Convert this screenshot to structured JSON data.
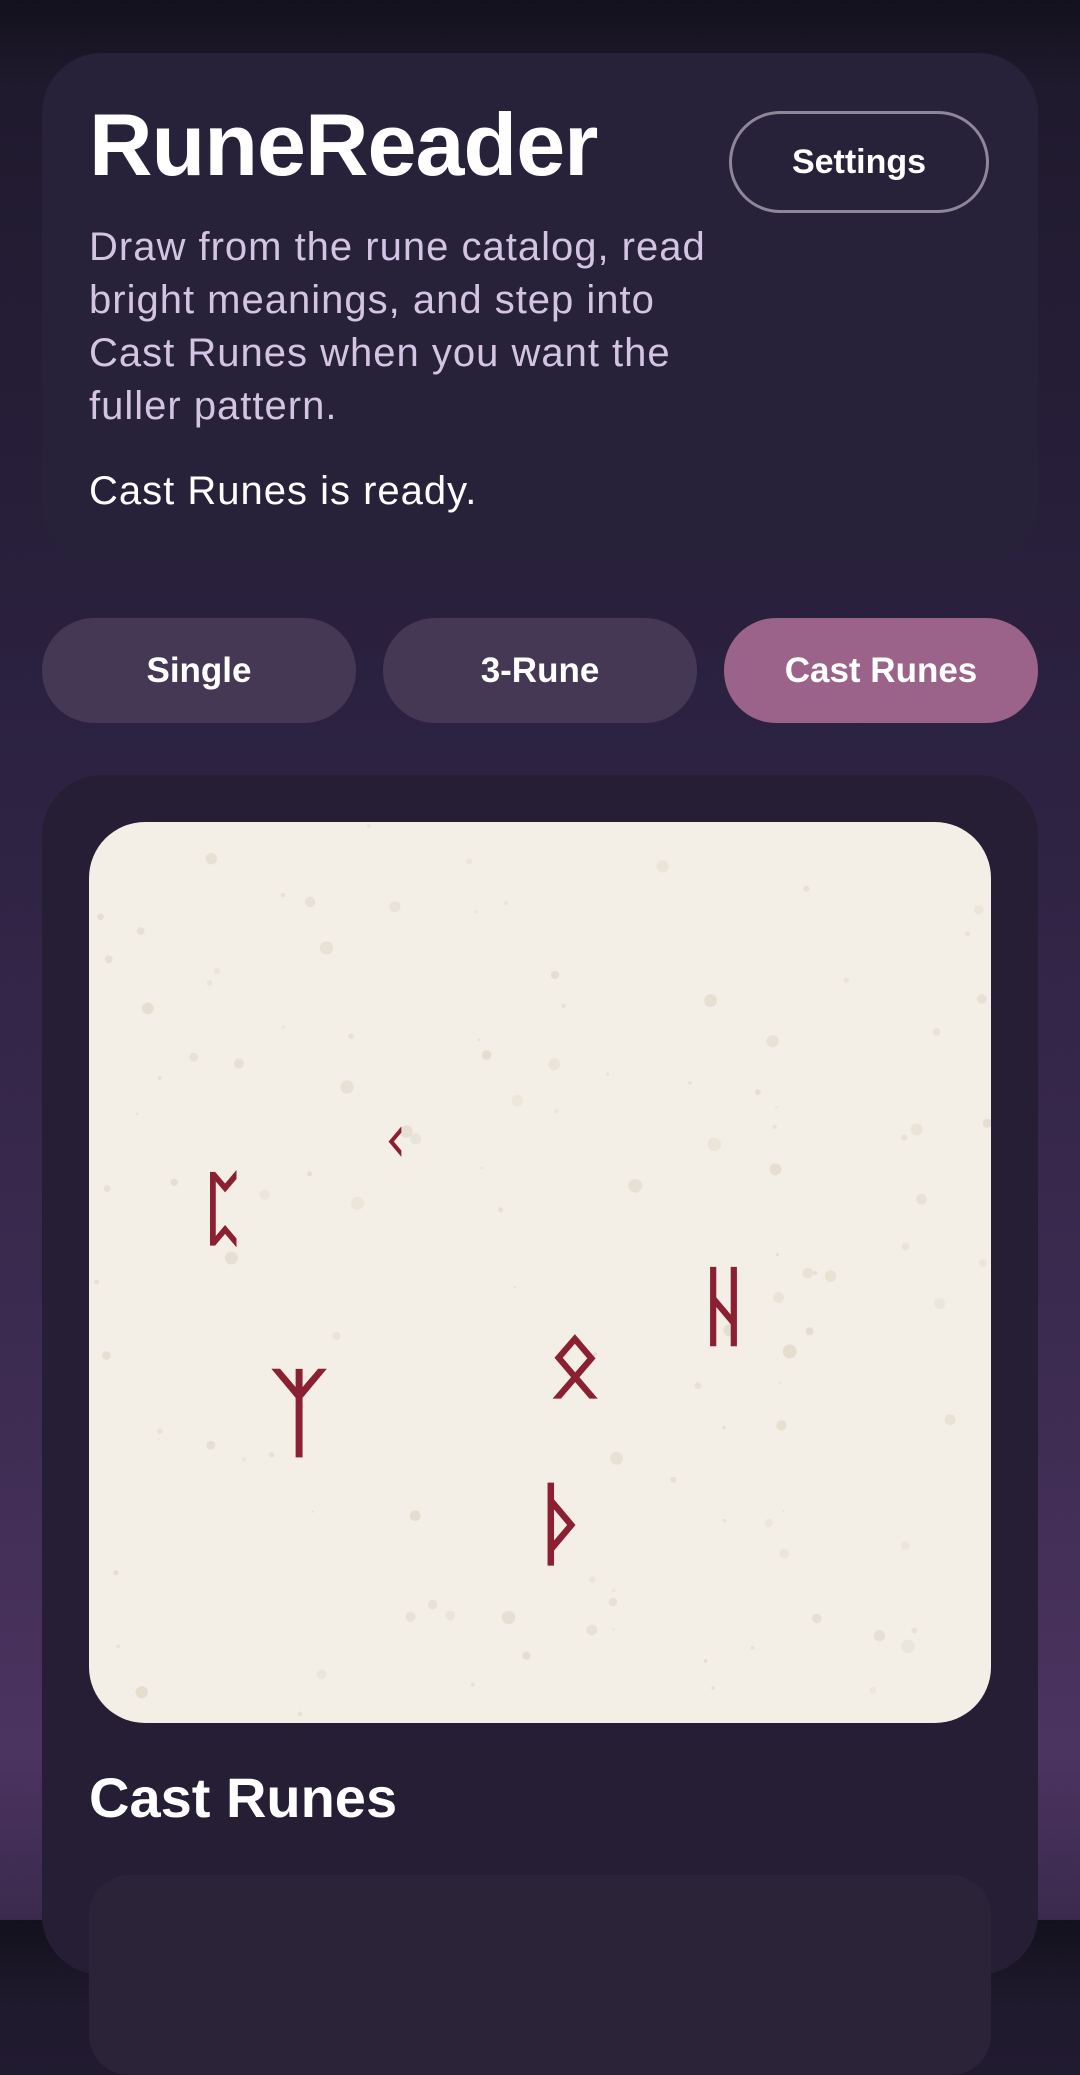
{
  "header": {
    "title": "RuneReader",
    "settings_label": "Settings",
    "description": "Draw from the rune catalog, read bright meanings, and step into Cast Runes when you want the fuller pattern.",
    "status": "Cast Runes is ready."
  },
  "modes": {
    "selected": "Cast Runes",
    "tabs": [
      {
        "label": "Single"
      },
      {
        "label": "3-Rune"
      },
      {
        "label": "Cast Runes"
      }
    ]
  },
  "cast": {
    "section_title": "Cast Runes",
    "runes": [
      {
        "glyph": "ᛈ",
        "name": "perthro"
      },
      {
        "glyph": "ᚲ",
        "name": "kaunan"
      },
      {
        "glyph": "ᛉ",
        "name": "algiz"
      },
      {
        "glyph": "ᛟ",
        "name": "othala"
      },
      {
        "glyph": "ᚦ",
        "name": "thurisaz"
      },
      {
        "glyph": "ᚺ",
        "name": "hagalaz"
      }
    ]
  },
  "colors": {
    "accent": "#9b628a",
    "rune": "#8c2033",
    "board": "#f3efe6",
    "tab": "#453854"
  }
}
